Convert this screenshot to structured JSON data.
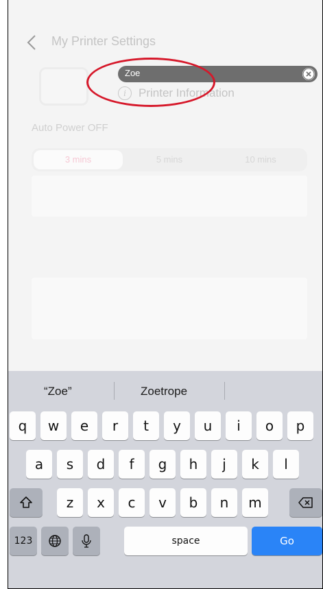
{
  "nav": {
    "title": "My Printer Settings"
  },
  "printer": {
    "name_value": "Zoe",
    "info_label": "Printer Information",
    "info_icon": "i"
  },
  "auto_power": {
    "label": "Auto Power OFF",
    "options": [
      "3 mins",
      "5 mins",
      "10 mins"
    ],
    "selected": "3 mins"
  },
  "keyboard": {
    "suggestions": [
      "“Zoe”",
      "Zoetrope"
    ],
    "row1": [
      "q",
      "w",
      "e",
      "r",
      "t",
      "y",
      "u",
      "i",
      "o",
      "p"
    ],
    "row2": [
      "a",
      "s",
      "d",
      "f",
      "g",
      "h",
      "j",
      "k",
      "l"
    ],
    "row3": [
      "z",
      "x",
      "c",
      "v",
      "b",
      "n",
      "m"
    ],
    "numbers_label": "123",
    "space_label": "space",
    "go_label": "Go",
    "go_color": "#2a84f7"
  },
  "annotation_color": "#d6182a",
  "icons": [
    "back-chevron-icon",
    "clear-circle-icon",
    "info-circle-icon",
    "shift-icon",
    "delete-icon",
    "globe-icon",
    "microphone-icon"
  ]
}
